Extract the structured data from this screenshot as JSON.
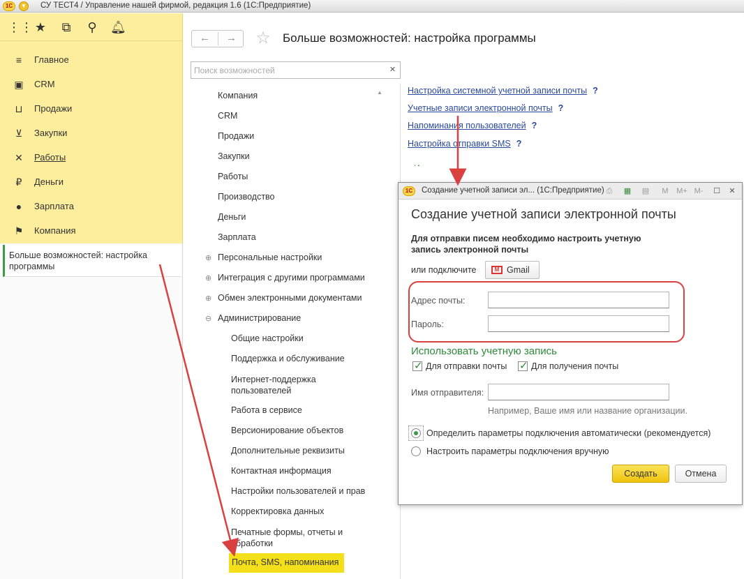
{
  "window": {
    "title": "СУ ТЕСТ4 / Управление нашей фирмой, редакция 1.6  (1С:Предприятие)",
    "logo": "1С"
  },
  "sidebar": {
    "sections": [
      {
        "label": "Главное",
        "icon": "menu-lines-icon"
      },
      {
        "label": "CRM",
        "icon": "crm-card-icon"
      },
      {
        "label": "Продажи",
        "icon": "basket-icon"
      },
      {
        "label": "Закупки",
        "icon": "cart-icon"
      },
      {
        "label": "Работы",
        "icon": "tools-icon"
      },
      {
        "label": "Деньги",
        "icon": "ruble-icon"
      },
      {
        "label": "Зарплата",
        "icon": "person-icon"
      },
      {
        "label": "Компания",
        "icon": "flag-icon"
      }
    ],
    "active_panel": "Больше возможностей: настройка программы"
  },
  "main": {
    "title": "Больше возможностей: настройка программы",
    "search_placeholder": "Поиск возможностей",
    "tree": [
      {
        "label": "Компания"
      },
      {
        "label": "CRM"
      },
      {
        "label": "Продажи"
      },
      {
        "label": "Закупки"
      },
      {
        "label": "Работы"
      },
      {
        "label": "Производство"
      },
      {
        "label": "Деньги"
      },
      {
        "label": "Зарплата"
      },
      {
        "label": "Персональные настройки"
      },
      {
        "label": "Интеграция с другими программами"
      },
      {
        "label": "Обмен электронными документами"
      },
      {
        "label": "Администрирование"
      }
    ],
    "admin_children": [
      "Общие настройки",
      "Поддержка и обслуживание",
      "Интернет-поддержка пользователей",
      "Работа в сервисе",
      "Версионирование объектов",
      "Дополнительные реквизиты",
      "Контактная информация",
      "Настройки пользователей и прав",
      "Корректировка данных",
      "Печатные формы, отчеты и обработки",
      "Почта, SMS, напоминания"
    ],
    "links": [
      "Настройка системной учетной записи почты",
      "Учетные записи электронной почты",
      "Напоминания пользователей",
      "Настройка отправки SMS"
    ],
    "link_help": "?",
    "partial_behind": "Использовать учетную запись"
  },
  "dialog": {
    "title": "Создание учетной записи эл...  (1С:Предприятие)",
    "heading": "Создание учетной записи электронной почты",
    "instruction": "Для отправки писем необходимо настроить учетную запись электронной почты",
    "or_connect": "или подключите",
    "gmail": "Gmail",
    "email_label": "Адрес почты:",
    "password_label": "Пароль:",
    "use_account": "Использовать учетную запись",
    "for_sending": "Для отправки почты",
    "for_receiving": "Для получения почты",
    "sender_label": "Имя отправителя:",
    "example": "Например, Ваше имя или название организации.",
    "radio_auto": "Определить параметры подключения автоматически (рекомендуется)",
    "radio_manual": "Настроить параметры подключения вручную",
    "create": "Создать",
    "cancel": "Отмена",
    "toolbar_m": "M",
    "toolbar_mplus": "M+",
    "toolbar_mminus": "M-"
  },
  "colors": {
    "accent": "#fcee9c",
    "highlight": "#f4e01a",
    "green": "#2e8b3a",
    "link": "#2b4a9e",
    "annotation": "#d94040"
  }
}
